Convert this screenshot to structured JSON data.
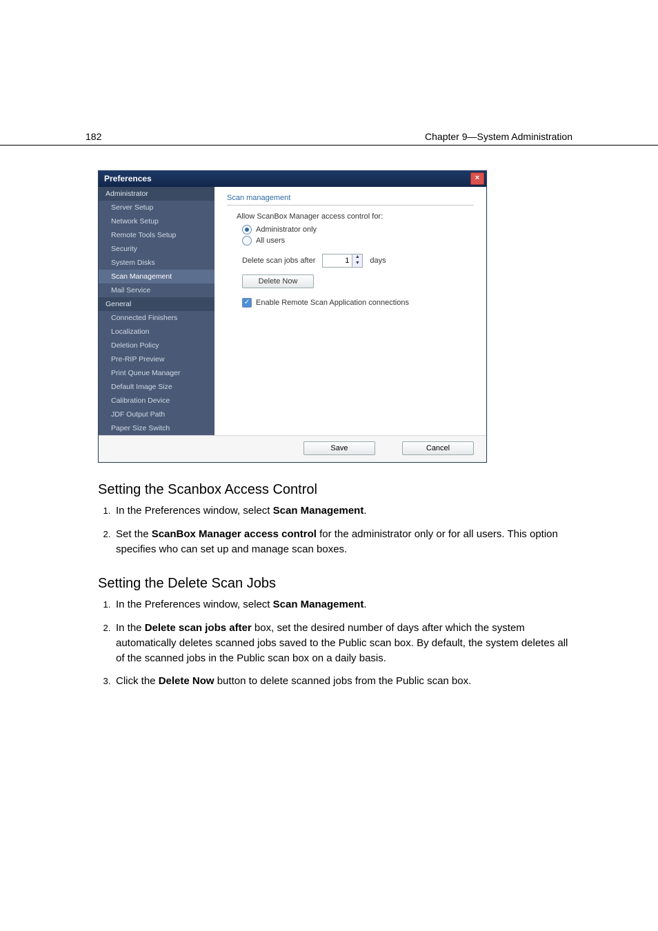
{
  "header": {
    "page_number": "182",
    "chapter_line": "Chapter 9—System Administration"
  },
  "dialog": {
    "title": "Preferences",
    "sidebar": {
      "group1_header": "Administrator",
      "group1_items": [
        "Server Setup",
        "Network Setup",
        "Remote Tools Setup",
        "Security",
        "System Disks",
        "Scan Management",
        "Mail Service"
      ],
      "group1_selected_index": 5,
      "group2_header": "General",
      "group2_items": [
        "Connected Finishers",
        "Localization",
        "Deletion Policy",
        "Pre-RIP Preview",
        "Print Queue Manager",
        "Default Image Size",
        "Calibration Device",
        "JDF Output Path",
        "Paper Size Switch"
      ]
    },
    "panel": {
      "section_title": "Scan management",
      "access_label": "Allow ScanBox Manager access control for:",
      "radio_admin": "Administrator only",
      "radio_all": "All users",
      "delete_label": "Delete scan jobs after",
      "delete_value": "1",
      "delete_unit": "days",
      "delete_now": "Delete Now",
      "enable_remote": "Enable Remote Scan Application connections"
    },
    "footer": {
      "save": "Save",
      "cancel": "Cancel"
    }
  },
  "doc": {
    "sec1_title": "Setting the Scanbox Access Control",
    "sec1_step1_a": "In the Preferences window, select ",
    "sec1_step1_b": "Scan Management",
    "sec1_step1_c": ".",
    "sec1_step2_a": "Set the ",
    "sec1_step2_b": "ScanBox Manager access control",
    "sec1_step2_c": " for the administrator only or for all users. This option specifies who can set up and manage scan boxes.",
    "sec2_title": "Setting the Delete Scan Jobs",
    "sec2_step1_a": "In the Preferences window, select ",
    "sec2_step1_b": "Scan Management",
    "sec2_step1_c": ".",
    "sec2_step2_a": "In the ",
    "sec2_step2_b": "Delete scan jobs after",
    "sec2_step2_c": " box, set the desired number of days after which the system automatically deletes scanned jobs saved to the Public scan box. By default, the system deletes all of the scanned jobs in the Public scan box on a daily basis.",
    "sec2_step3_a": "Click the ",
    "sec2_step3_b": "Delete Now",
    "sec2_step3_c": " button to delete scanned jobs from the Public scan box."
  }
}
